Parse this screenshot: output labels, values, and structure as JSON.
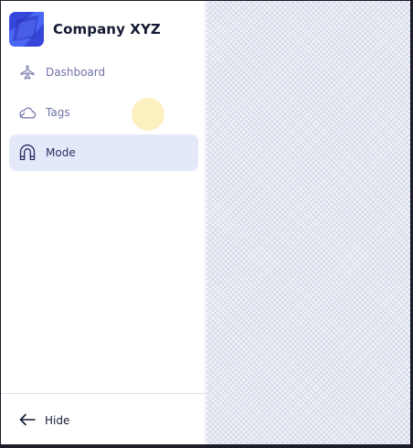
{
  "app": {
    "company_name": "Company XYZ",
    "logo_icon": "company-logo",
    "brand_color": "#3d4de0"
  },
  "sidebar": {
    "items": [
      {
        "label": "Dashboard",
        "icon": "airplane-icon",
        "active": false
      },
      {
        "label": "Tags",
        "icon": "cloud-icon",
        "active": false
      },
      {
        "label": "Mode",
        "icon": "arch-icon",
        "active": true
      }
    ],
    "active_bg": "#e4e9f9"
  },
  "footer": {
    "hide_label": "Hide",
    "hide_icon": "arrow-left-icon"
  }
}
